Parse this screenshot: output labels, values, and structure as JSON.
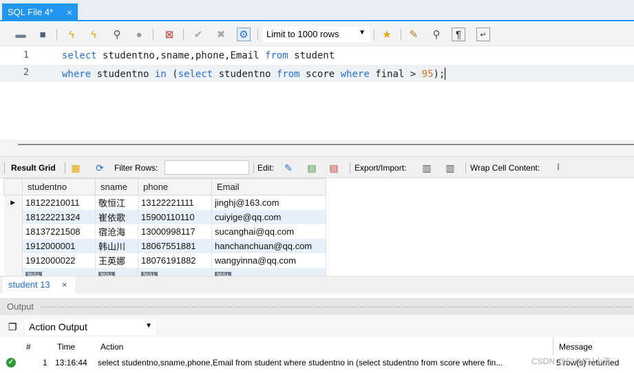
{
  "editor_tab": {
    "label": "SQL File 4*",
    "close": "×"
  },
  "toolbar": {
    "limit_label": "Limit to 1000 rows"
  },
  "editor": {
    "lines": [
      {
        "num": "1",
        "tokens": [
          {
            "t": "select",
            "k": "kw"
          },
          {
            "t": " studentno,sname,phone,Email ",
            "k": ""
          },
          {
            "t": "from",
            "k": "kw"
          },
          {
            "t": " student",
            "k": ""
          }
        ]
      },
      {
        "num": "2",
        "tokens": [
          {
            "t": "where",
            "k": "kw"
          },
          {
            "t": " studentno ",
            "k": ""
          },
          {
            "t": "in",
            "k": "kw"
          },
          {
            "t": " (",
            "k": ""
          },
          {
            "t": "select",
            "k": "kw"
          },
          {
            "t": " studentno ",
            "k": ""
          },
          {
            "t": "from",
            "k": "kw"
          },
          {
            "t": " score ",
            "k": ""
          },
          {
            "t": "where",
            "k": "kw"
          },
          {
            "t": " final > ",
            "k": ""
          },
          {
            "t": "95",
            "k": "num"
          },
          {
            "t": ");",
            "k": ""
          }
        ]
      }
    ]
  },
  "result_toolbar": {
    "result_grid": "Result Grid",
    "filter_rows": "Filter Rows:",
    "edit": "Edit:",
    "export_import": "Export/Import:",
    "wrap_cell": "Wrap Cell Content:"
  },
  "grid": {
    "columns": [
      "studentno",
      "sname",
      "phone",
      "Email"
    ],
    "rows": [
      [
        "18122210011",
        "敬恒江",
        "13122221111",
        "jinghj@163.com"
      ],
      [
        "18122221324",
        "崔依歌",
        "15900110110",
        "cuiyige@qq.com"
      ],
      [
        "18137221508",
        "宿沧海",
        "13000998117",
        "sucanghai@qq.com"
      ],
      [
        "1912000001",
        "韩山川",
        "18067551881",
        "hanchanchuan@qq.com"
      ],
      [
        "1912000022",
        "王英娜",
        "18076191882",
        "wangyinna@qq.com"
      ]
    ],
    "null_label": "NULL"
  },
  "result_tab": {
    "label": "student 13",
    "close": "×"
  },
  "output": {
    "title": "Output",
    "selector": "Action Output",
    "headers": {
      "hash": "#",
      "time": "Time",
      "action": "Action",
      "message": "Message"
    },
    "row": {
      "num": "1",
      "time": "13:16:44",
      "action": "select studentno,sname,phone,Email from student  where studentno in (select studentno from score where fin...",
      "message": "5 row(s) returned"
    }
  },
  "watermark": "CSDN @GUMPJ小流"
}
